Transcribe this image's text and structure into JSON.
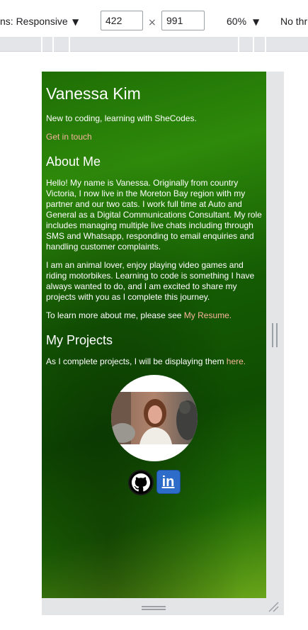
{
  "toolbar": {
    "device_label": "ns: Responsive",
    "width_value": "422",
    "times": "×",
    "height_value": "991",
    "zoom": "60%",
    "throttle": "No thr"
  },
  "page": {
    "title": "Vanessa Kim",
    "tagline": "New to coding, learning with SheCodes.",
    "contact_link": "Get in touch",
    "about_heading": "About Me",
    "about_p1": "Hello! My name is Vanessa. Originally from country Victoria, I now live in the Moreton Bay region with my partner and our two cats. I work full time at Auto and General as a Digital Communications Consultant. My role includes managing multiple live chats including through SMS and Whatsapp, responding to email enquiries and handling customer complaints.",
    "about_p2": "I am an animal lover, enjoy playing video games and riding motorbikes. Learning to code is something I have always wanted to do, and I am excited to share my projects with you as I complete this journey.",
    "resume_prefix": "To learn more about me, please see ",
    "resume_link": "My Resume.",
    "projects_heading": "My Projects",
    "projects_prefix": "As I complete projects, I will be displaying them ",
    "projects_link": "here.",
    "linkedin_text": "in"
  },
  "colors": {
    "background_green": "#1f6e05",
    "link": "#f7b39c",
    "linkedin": "#2d6cc8"
  },
  "icons": [
    "github-icon",
    "linkedin-icon",
    "caret-down-icon",
    "resize-corner-icon"
  ]
}
